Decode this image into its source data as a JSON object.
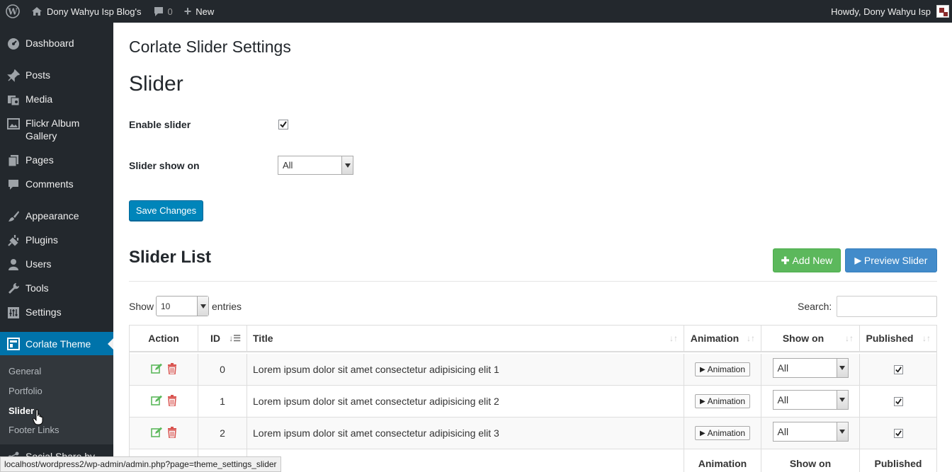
{
  "adminbar": {
    "site_name": "Dony Wahyu Isp Blog's",
    "comments_count": "0",
    "new_label": "New",
    "howdy": "Howdy, Dony Wahyu Isp"
  },
  "sidebar": {
    "items": [
      {
        "label": "Dashboard",
        "icon": "dashboard-icon"
      },
      {
        "label": "Posts",
        "icon": "pin-icon"
      },
      {
        "label": "Media",
        "icon": "media-icon"
      },
      {
        "label": "Flickr Album Gallery",
        "icon": "gallery-icon"
      },
      {
        "label": "Pages",
        "icon": "pages-icon"
      },
      {
        "label": "Comments",
        "icon": "comment-icon"
      },
      {
        "label": "Appearance",
        "icon": "brush-icon"
      },
      {
        "label": "Plugins",
        "icon": "plug-icon"
      },
      {
        "label": "Users",
        "icon": "user-icon"
      },
      {
        "label": "Tools",
        "icon": "wrench-icon"
      },
      {
        "label": "Settings",
        "icon": "settings-icon"
      },
      {
        "label": "Corlate Theme",
        "icon": "theme-icon"
      },
      {
        "label": "Social Share by",
        "icon": "share-icon"
      }
    ],
    "submenu": [
      "General",
      "Portfolio",
      "Slider",
      "Footer Links"
    ]
  },
  "main": {
    "page_title": "Corlate Slider Settings",
    "section_title": "Slider",
    "enable_label": "Enable slider",
    "enable_checked": true,
    "show_on_label": "Slider show on",
    "show_on_value": "All",
    "save_label": "Save Changes",
    "list_title": "Slider List",
    "add_new_label": "Add New",
    "preview_label": "Preview Slider",
    "show_label": "Show",
    "entries_value": "10",
    "entries_label": "entries",
    "search_label": "Search:"
  },
  "table": {
    "headers": [
      "Action",
      "ID",
      "Title",
      "Animation",
      "Show on",
      "Published"
    ],
    "rows": [
      {
        "id": "0",
        "title": "Lorem ipsum dolor sit amet consectetur adipisicing elit 1",
        "animation": "Animation",
        "show_on": "All",
        "published": true
      },
      {
        "id": "1",
        "title": "Lorem ipsum dolor sit amet consectetur adipisicing elit 2",
        "animation": "Animation",
        "show_on": "All",
        "published": true
      },
      {
        "id": "2",
        "title": "Lorem ipsum dolor sit amet consectetur adipisicing elit 3",
        "animation": "Animation",
        "show_on": "All",
        "published": true
      }
    ],
    "footer": [
      "Animation",
      "Show on",
      "Published"
    ]
  },
  "statusbar": {
    "url": "localhost/wordpress2/wp-admin/admin.php?page=theme_settings_slider"
  },
  "colors": {
    "sidebar": "#23282d",
    "active": "#0073aa",
    "green": "#5cb85c",
    "blue": "#428bca"
  }
}
